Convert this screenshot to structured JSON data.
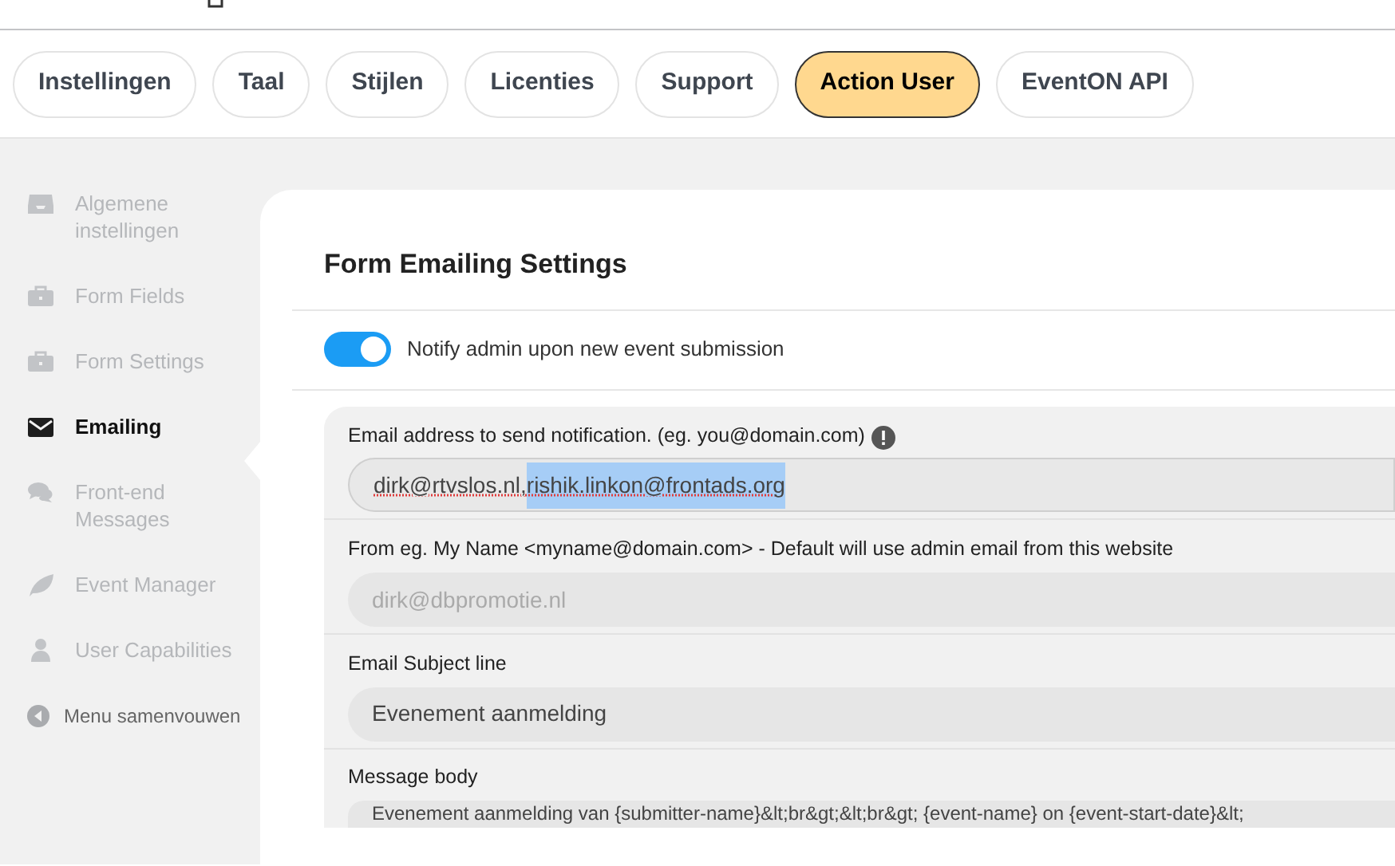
{
  "tabs": [
    {
      "label": "Instellingen",
      "selected": false
    },
    {
      "label": "Taal",
      "selected": false
    },
    {
      "label": "Stijlen",
      "selected": false
    },
    {
      "label": "Licenties",
      "selected": false
    },
    {
      "label": "Support",
      "selected": false
    },
    {
      "label": "Action User",
      "selected": true
    },
    {
      "label": "EventON API",
      "selected": false
    }
  ],
  "sidebar": {
    "items": [
      {
        "label": "Algemene instellingen",
        "selected": false
      },
      {
        "label": "Form Fields",
        "selected": false
      },
      {
        "label": "Form Settings",
        "selected": false
      },
      {
        "label": "Emailing",
        "selected": true
      },
      {
        "label": "Front-end Messages",
        "selected": false
      },
      {
        "label": "Event Manager",
        "selected": false
      },
      {
        "label": "User Capabilities",
        "selected": false
      }
    ],
    "collapse": "Menu samenvouwen"
  },
  "section": {
    "title": "Form Emailing Settings",
    "toggle": {
      "label": "Notify admin upon new event submission",
      "on": true
    },
    "fields": [
      {
        "label": "Email address to send notification. (eg. you@domain.com)",
        "value_parts": [
          {
            "text": "dirk@rtvslos.nl,",
            "selected": false
          },
          {
            "text": "rishik.linkon@frontads.org",
            "selected": true
          }
        ]
      },
      {
        "label": "From eg. My Name <myname@domain.com> - Default will use admin email from this website",
        "placeholder": "dirk@dbpromotie.nl"
      },
      {
        "label": "Email Subject line",
        "value": "Evenement aanmelding"
      },
      {
        "label": "Message body",
        "value": "Evenement aanmelding van {submitter-name}&lt;br&gt;&lt;br&gt; {event-name} on {event-start-date}&lt;"
      }
    ]
  }
}
